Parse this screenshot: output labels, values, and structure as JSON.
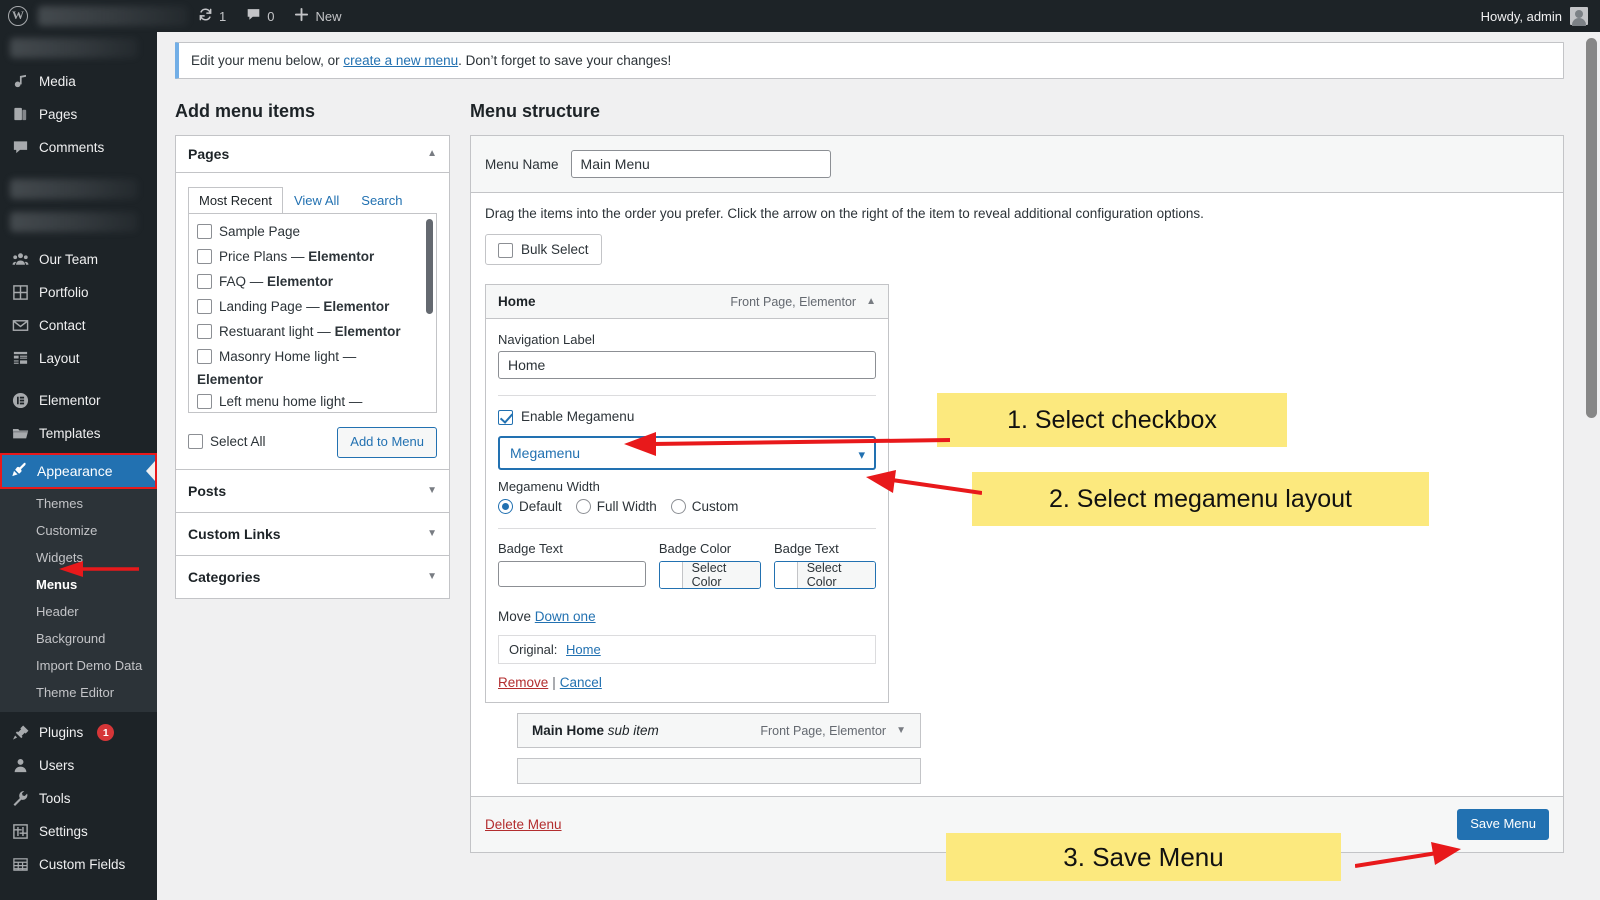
{
  "adminbar": {
    "logo_icon": "wordpress-icon",
    "updates_icon": "updates-icon",
    "updates_count": "1",
    "comments_icon": "comment-icon",
    "comments_count": "0",
    "new_icon": "plus-icon",
    "new_label": "New",
    "account_label": "Howdy, admin",
    "avatar_icon": "avatar-icon"
  },
  "sidebar": {
    "items": [
      {
        "label": "Media",
        "icon": "media-icon"
      },
      {
        "label": "Pages",
        "icon": "pages-icon"
      },
      {
        "label": "Comments",
        "icon": "comment-icon"
      },
      {
        "label": "Our Team",
        "icon": "users-group-icon"
      },
      {
        "label": "Portfolio",
        "icon": "grid-icon"
      },
      {
        "label": "Contact",
        "icon": "envelope-icon"
      },
      {
        "label": "Layout",
        "icon": "layout-icon"
      },
      {
        "label": "Elementor",
        "icon": "elementor-icon"
      },
      {
        "label": "Templates",
        "icon": "folder-icon"
      }
    ],
    "appearance": {
      "label": "Appearance",
      "icon": "brush-icon"
    },
    "appearance_submenu": [
      {
        "label": "Themes",
        "current": false
      },
      {
        "label": "Customize",
        "current": false
      },
      {
        "label": "Widgets",
        "current": false
      },
      {
        "label": "Menus",
        "current": true
      },
      {
        "label": "Header",
        "current": false
      },
      {
        "label": "Background",
        "current": false
      },
      {
        "label": "Import Demo Data",
        "current": false
      },
      {
        "label": "Theme Editor",
        "current": false
      }
    ],
    "bottom_items": [
      {
        "label": "Plugins",
        "icon": "plug-icon",
        "badge": "1"
      },
      {
        "label": "Users",
        "icon": "user-icon",
        "badge": ""
      },
      {
        "label": "Tools",
        "icon": "wrench-icon",
        "badge": ""
      },
      {
        "label": "Settings",
        "icon": "sliders-icon",
        "badge": ""
      },
      {
        "label": "Custom Fields",
        "icon": "table-icon",
        "badge": ""
      }
    ]
  },
  "notice": {
    "prefix": "Edit your menu below, or ",
    "link": "create a new menu",
    "suffix": ". Don’t forget to save your changes!"
  },
  "add_menu_items": {
    "title": "Add menu items",
    "pages_panel": {
      "header": "Pages",
      "collapse_icon": "chevron-up-icon",
      "tabs": [
        {
          "label": "Most Recent",
          "active": true
        },
        {
          "label": "View All",
          "active": false
        },
        {
          "label": "Search",
          "active": false
        }
      ],
      "items": [
        {
          "label": "Sample Page",
          "suffix": "",
          "checked": false
        },
        {
          "label": "Price Plans — ",
          "suffix": "Elementor",
          "checked": false
        },
        {
          "label": "FAQ — ",
          "suffix": "Elementor",
          "checked": false
        },
        {
          "label": "Landing Page — ",
          "suffix": "Elementor",
          "checked": false
        },
        {
          "label": "Restuarant light — ",
          "suffix": "Elementor",
          "checked": false
        },
        {
          "label": "Masonry Home light — ",
          "suffix": "",
          "checked": false
        }
      ],
      "continuation": "Elementor",
      "last_item": {
        "label": "Left menu home light — ",
        "checked": false
      },
      "select_all_label": "Select All",
      "add_button": "Add to Menu"
    },
    "accordions": [
      {
        "label": "Posts",
        "icon": "chevron-down-icon"
      },
      {
        "label": "Custom Links",
        "icon": "chevron-down-icon"
      },
      {
        "label": "Categories",
        "icon": "chevron-down-icon"
      }
    ]
  },
  "menu_structure": {
    "title": "Menu structure",
    "menu_name_label": "Menu Name",
    "menu_name_value": "Main Menu",
    "help_text": "Drag the items into the order you prefer. Click the arrow on the right of the item to reveal additional configuration options.",
    "bulk_select_label": "Bulk Select",
    "item": {
      "title": "Home",
      "meta": "Front Page, Elementor",
      "collapse_icon": "chevron-up-icon",
      "nav_label_label": "Navigation Label",
      "nav_label_value": "Home",
      "enable_megamenu_label": "Enable Megamenu",
      "enable_megamenu_checked": true,
      "layout_select_value": "Megamenu",
      "layout_select_icon": "chevron-down-icon",
      "width_label": "Megamenu Width",
      "width_options": [
        {
          "label": "Default",
          "selected": true
        },
        {
          "label": "Full Width",
          "selected": false
        },
        {
          "label": "Custom",
          "selected": false
        }
      ],
      "badge_text_label": "Badge Text",
      "badge_text_value": "",
      "badge_color_label": "Badge Color",
      "badge_color_button": "Select Color",
      "badge_text_label_2": "Badge Text",
      "badge_color_button_2": "Select Color",
      "move_label": "Move",
      "move_link": "Down one",
      "original_label": "Original:",
      "original_link": "Home",
      "remove_link": "Remove",
      "separator": "|",
      "cancel_link": "Cancel"
    },
    "sub_item": {
      "title": "Main Home",
      "sub_label": "sub item",
      "meta": "Front Page, Elementor",
      "expand_icon": "chevron-down-icon"
    },
    "delete_menu": "Delete Menu",
    "save_button": "Save Menu"
  },
  "annotations": [
    {
      "text": "1. Select checkbox",
      "icon": "arrow-left-icon"
    },
    {
      "text": "2. Select megamenu layout",
      "icon": "arrow-left-icon"
    },
    {
      "text": "3. Save Menu",
      "icon": "arrow-right-icon"
    }
  ],
  "colors": {
    "accent": "#2271b1",
    "admin_dark": "#1d2327",
    "highlight": "#fce97e",
    "arrow_red": "#e8191b",
    "danger": "#b32d2e",
    "badge_red": "#d63638"
  }
}
